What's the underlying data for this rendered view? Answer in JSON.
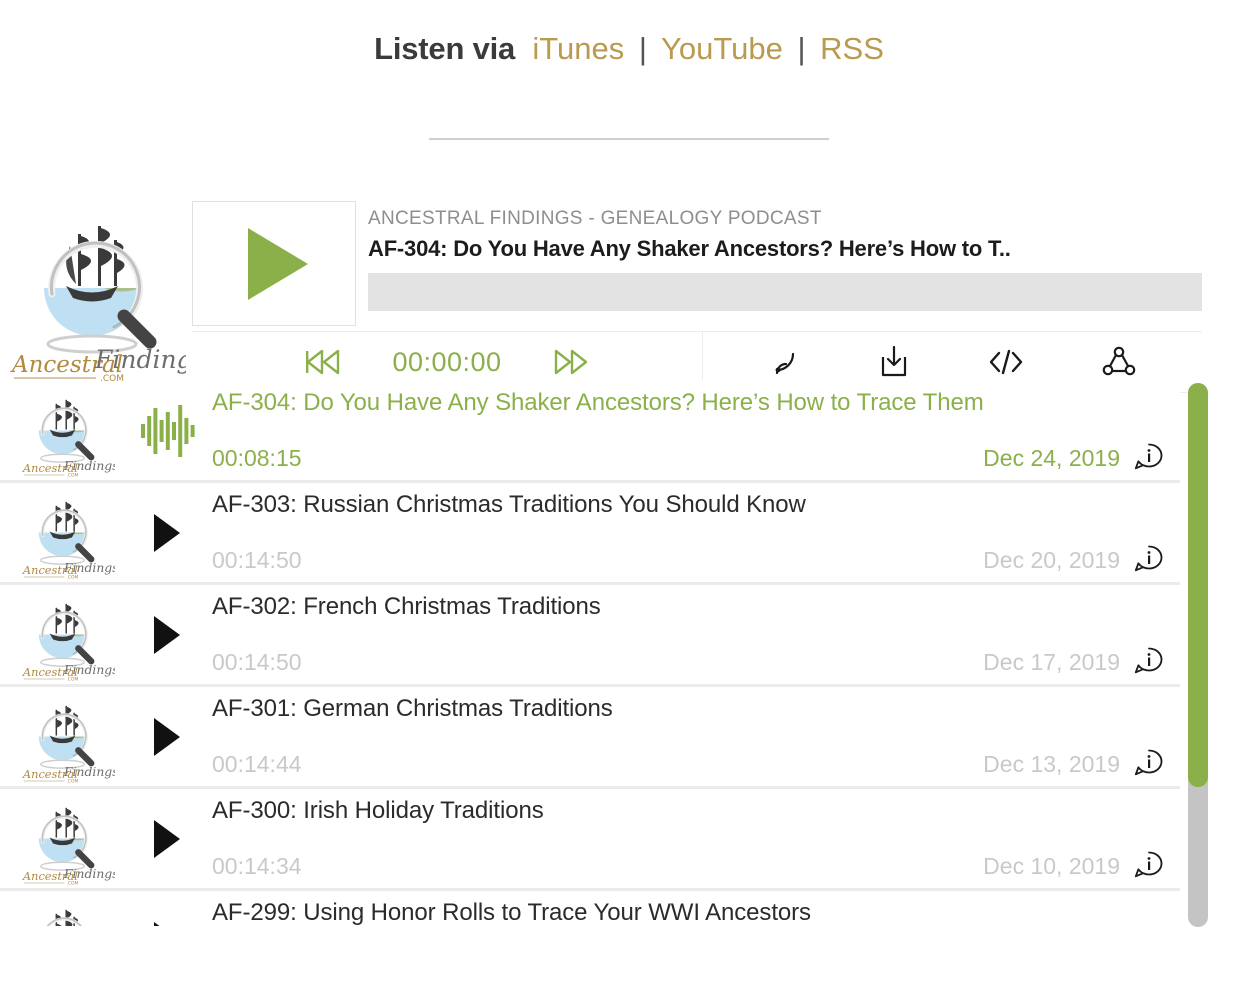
{
  "header": {
    "label": "Listen via",
    "separator": "|",
    "links": [
      {
        "name": "itunes",
        "text": "iTunes"
      },
      {
        "name": "youtube",
        "text": "YouTube"
      },
      {
        "name": "rss",
        "text": "RSS"
      }
    ]
  },
  "colors": {
    "accent_green": "#8bb04a",
    "link_gold": "#b99a4f",
    "seekbar_gray": "#e3e3e3",
    "muted_gray": "#c9c9c9",
    "scroll_track": "#c4c4c4"
  },
  "player": {
    "cover_alt": "ancestral-findings-logo",
    "play_icon": "play-icon",
    "show_name": "ANCESTRAL FINDINGS - GENEALOGY PODCAST",
    "episode_title": "AF-304: Do You Have Any Shaker Ancestors? Here’s How to T..",
    "current_time": "00:00:00",
    "rewind_icon": "rewind-icon",
    "forward_icon": "fast-forward-icon",
    "tools": [
      {
        "name": "rss-feed-icon",
        "label": "RSS Feed"
      },
      {
        "name": "download-icon",
        "label": "Download"
      },
      {
        "name": "embed-code-icon",
        "label": "Embed"
      },
      {
        "name": "share-icon",
        "label": "Share"
      }
    ]
  },
  "playlist": {
    "info_icon": "info-bubble-icon",
    "waveform_icon": "waveform-icon",
    "episodes": [
      {
        "title": "AF-304: Do You Have Any Shaker Ancestors? Here’s How to Trace Them",
        "duration": "00:08:15",
        "date": "Dec 24, 2019",
        "active": true
      },
      {
        "title": "AF-303: Russian Christmas Traditions You Should Know",
        "duration": "00:14:50",
        "date": "Dec 20, 2019",
        "active": false
      },
      {
        "title": "AF-302: French Christmas Traditions",
        "duration": "00:14:50",
        "date": "Dec 17, 2019",
        "active": false
      },
      {
        "title": "AF-301: German Christmas Traditions",
        "duration": "00:14:44",
        "date": "Dec 13, 2019",
        "active": false
      },
      {
        "title": "AF-300: Irish Holiday Traditions",
        "duration": "00:14:34",
        "date": "Dec 10, 2019",
        "active": false
      },
      {
        "title": "AF-299: Using Honor Rolls to Trace Your WWI Ancestors",
        "duration": "",
        "date": "",
        "active": false
      }
    ]
  }
}
